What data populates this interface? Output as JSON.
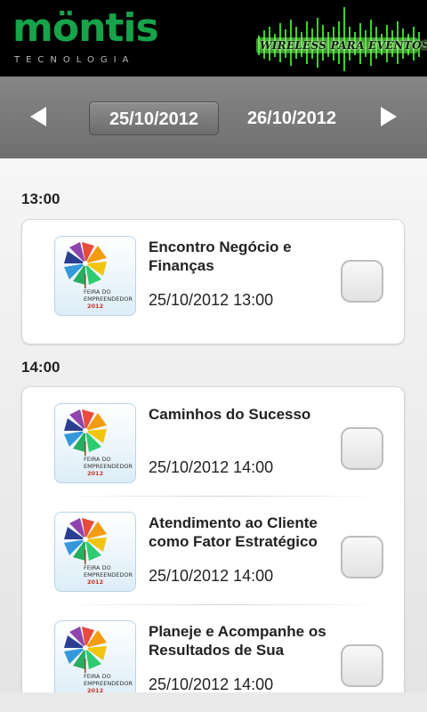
{
  "header": {
    "logo_text": "möntis",
    "logo_subtitle": "TECNOLOGIA",
    "banner_text": "WIRELESS PARA EVENTOS",
    "accent_green": "#16a34a"
  },
  "date_nav": {
    "prev_icon": "chevron-left-icon",
    "next_icon": "chevron-right-icon",
    "active_date": "25/10/2012",
    "next_date": "26/10/2012"
  },
  "schedule": [
    {
      "time": "13:00",
      "events": [
        {
          "title": "Encontro Negócio e Finanças",
          "datetime": "25/10/2012 13:00",
          "checked": false
        }
      ]
    },
    {
      "time": "14:00",
      "events": [
        {
          "title": "Caminhos do Sucesso",
          "datetime": "25/10/2012 14:00",
          "checked": false
        },
        {
          "title": "Atendimento  ao Cliente como Fator Estratégico",
          "datetime": "25/10/2012 14:00",
          "checked": false
        },
        {
          "title": "Planeje e Acompanhe os Resultados de Sua",
          "datetime": "25/10/2012 14:00",
          "checked": false
        }
      ]
    }
  ],
  "thumbnail": {
    "icon": "pinwheel-icon",
    "line1": "FEIRA DO",
    "line2": "EMPREENDEDOR",
    "year": "2012"
  }
}
